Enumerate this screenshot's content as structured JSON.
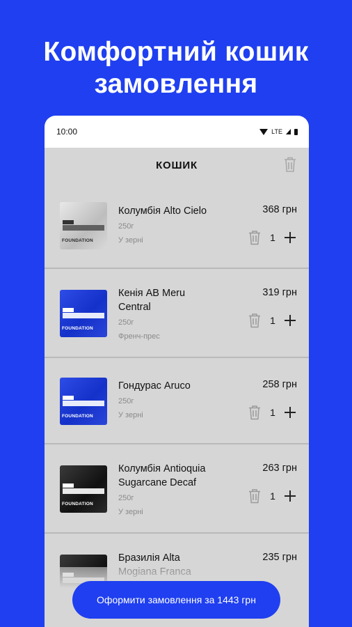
{
  "headline": {
    "line1": "Комфортний кошик",
    "line2": "замовлення"
  },
  "status_bar": {
    "time": "10:00",
    "network": "LTE"
  },
  "cart": {
    "title": "КОШИК",
    "items": [
      {
        "name": "Колумбія Alto Cielo",
        "weight": "250г",
        "grind": "У зерні",
        "price": "368 грн",
        "qty": "1",
        "bag": "light",
        "brand": "FOUNDATION"
      },
      {
        "name": "Кенія AB Meru Central",
        "weight": "250г",
        "grind": "Френч-прес",
        "price": "319 грн",
        "qty": "1",
        "bag": "blue",
        "brand": "FOUNDATION"
      },
      {
        "name": "Гондурас Aruco",
        "weight": "250г",
        "grind": "У зерні",
        "price": "258 грн",
        "qty": "1",
        "bag": "blue",
        "brand": "FOUNDATION"
      },
      {
        "name": "Колумбія Antioquia Sugarcane Decaf",
        "weight": "250г",
        "grind": "У зерні",
        "price": "263 грн",
        "qty": "1",
        "bag": "dark",
        "brand": "FOUNDATION"
      },
      {
        "name": "Бразилія Alta Mogiana Franca",
        "weight": "",
        "grind": "",
        "price": "235 грн",
        "qty": "",
        "bag": "dark",
        "brand": ""
      }
    ],
    "checkout_label": "Оформити замовлення за 1443 грн"
  },
  "icons": {
    "trash": "trash-icon",
    "plus": "plus-icon",
    "wifi": "wifi-icon",
    "battery": "battery-icon"
  },
  "colors": {
    "brand_blue": "#1f3ff0",
    "app_bg": "#d6d6d6"
  }
}
